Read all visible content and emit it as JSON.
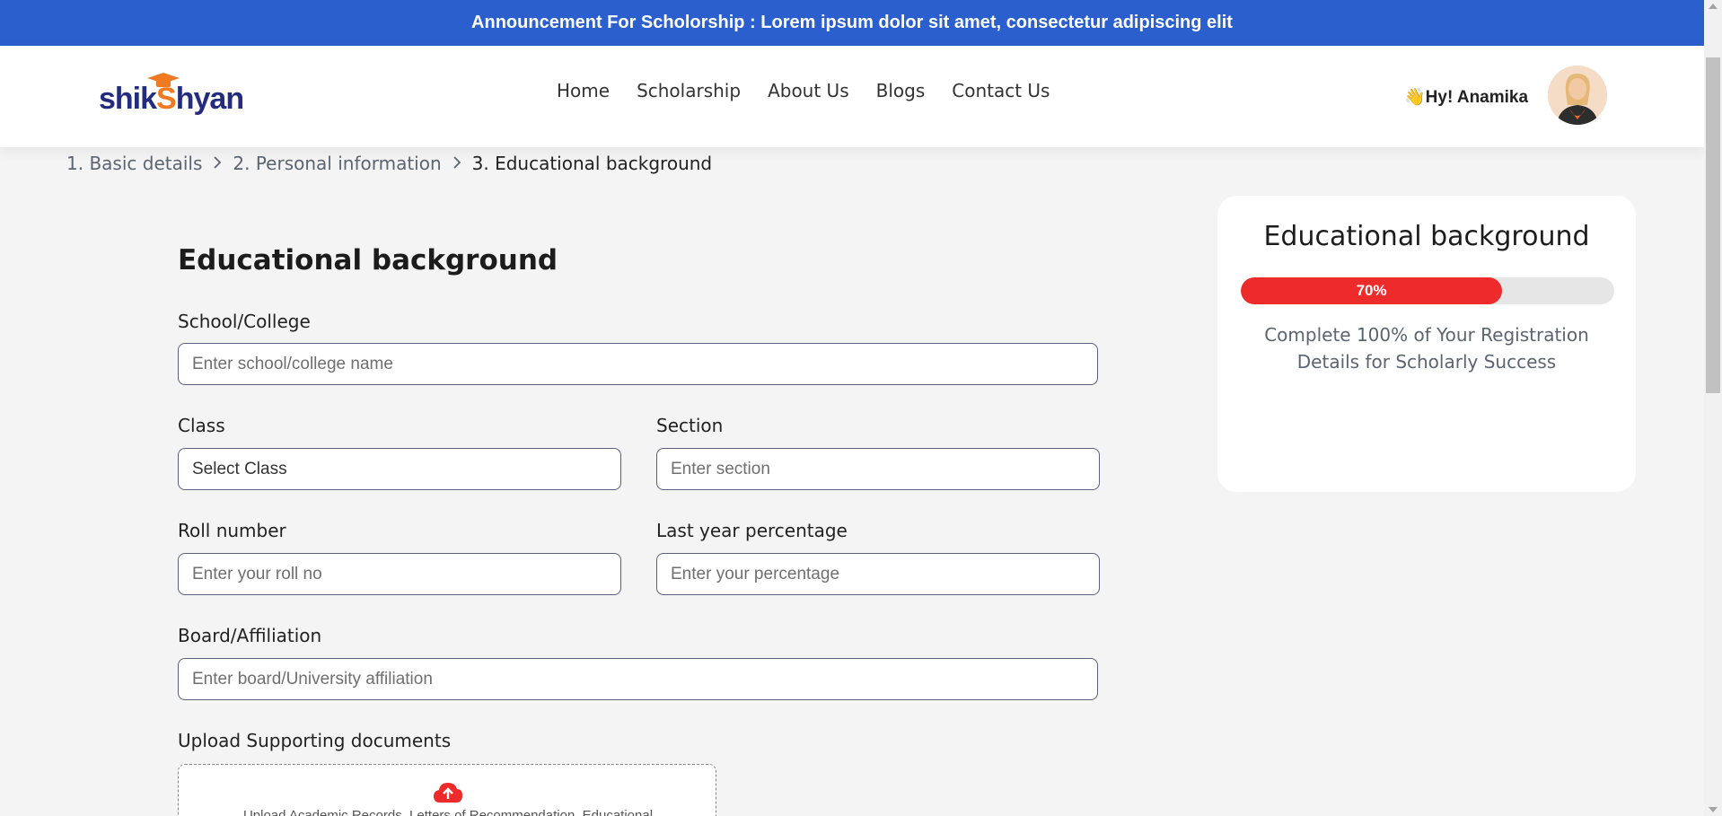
{
  "announcement": {
    "text": "Announcement For Scholorship : Lorem ipsum dolor sit amet, consectetur adipiscing elit"
  },
  "header": {
    "logo_text_1": "shik",
    "logo_text_2": "hyan",
    "nav": [
      "Home",
      "Scholarship",
      "About Us",
      "Blogs",
      "Contact Us"
    ],
    "greeting": "👋Hy! Anamika",
    "avatar_icon": "user-avatar"
  },
  "breadcrumb": {
    "steps": [
      "1. Basic details",
      "2. Personal information",
      "3. Educational background"
    ]
  },
  "form": {
    "title": "Educational background",
    "school_label": "School/College",
    "school_placeholder": "Enter school/college name",
    "class_label": "Class",
    "class_value": "Select Class",
    "section_label": "Section",
    "section_placeholder": "Enter section",
    "roll_label": "Roll number",
    "roll_placeholder": "Enter your roll no",
    "percentage_label": "Last year percentage",
    "percentage_placeholder": "Enter your percentage",
    "board_label": "Board/Affiliation",
    "board_placeholder": "Enter board/University affiliation",
    "upload_label": "Upload Supporting documents",
    "upload_text": "Upload Academic Records, Letters of Recommendation, Educational",
    "upload_icon": "cloud-upload-icon"
  },
  "progress_card": {
    "title": "Educational background",
    "progress_percent": 70,
    "progress_label": "70%",
    "description": "Complete 100% of Your Registration Details for Scholarly Success"
  },
  "colors": {
    "announcement_bg": "#2b5fce",
    "brand_navy": "#242c7e",
    "brand_orange": "#f07a22",
    "progress_fill": "#ee2b2b",
    "progress_track": "#e6e6e6"
  }
}
